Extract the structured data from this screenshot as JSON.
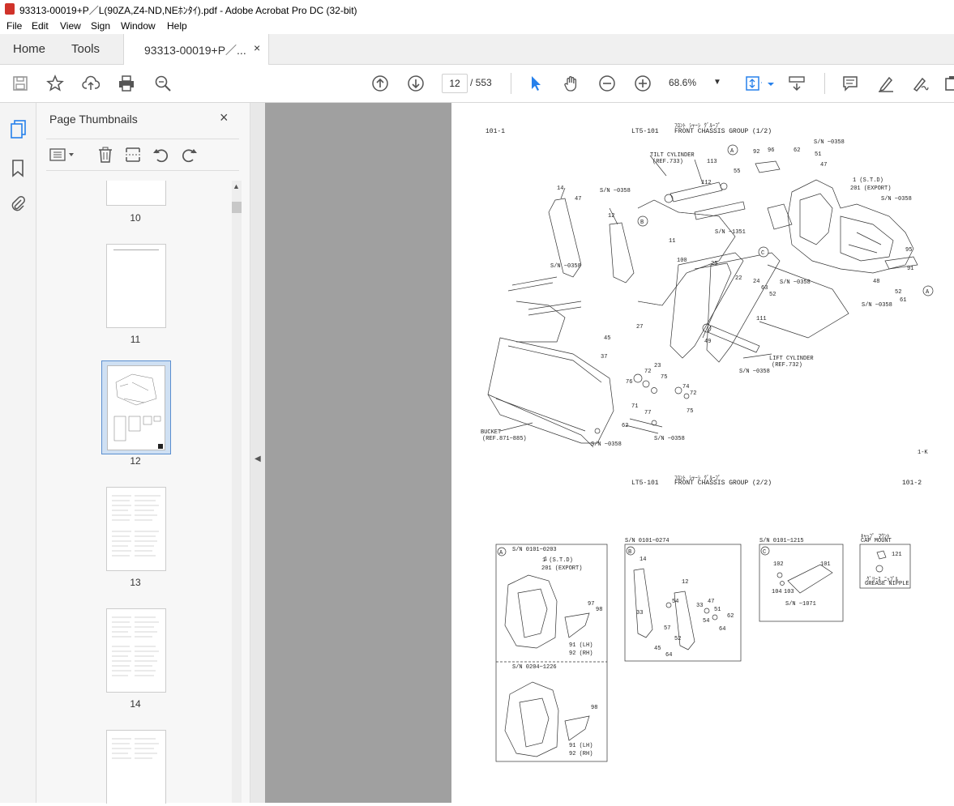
{
  "window": {
    "title": "93313-00019+P／L(90ZA,Z4-ND,NEﾎﾝﾀｲ).pdf - Adobe Acrobat Pro DC (32-bit)"
  },
  "menu": [
    "File",
    "Edit",
    "View",
    "Sign",
    "Window",
    "Help"
  ],
  "tabs": {
    "home": "Home",
    "tools": "Tools",
    "document": "93313-00019+P／...",
    "close": "×"
  },
  "toolbar": {
    "page_current": "12",
    "page_total": "/ 553",
    "zoom": "68.6%"
  },
  "thumbnails_panel": {
    "title": "Page Thumbnails",
    "close": "×",
    "pages": [
      "10",
      "11",
      "12",
      "13",
      "14"
    ],
    "selected": "12"
  },
  "document": {
    "top_left_code": "101-1",
    "top_title_code": "LT5-101",
    "top_title_kana": "ﾌﾛﾝﾄ ｼｬｰｼ ｸﾞﾙｰﾌﾟ",
    "top_title": "FRONT CHASSIS GROUP (1/2)",
    "bottom_title_code": "LT5-101",
    "bottom_title_kana": "ﾌﾛﾝﾄ ｼｬｰｼ ｸﾞﾙｰﾌﾟ",
    "bottom_title": "FRONT CHASSIS GROUP (2/2)",
    "bottom_right_code": "101-2",
    "corner_mark": "1-K",
    "labels": {
      "tilt_cylinder": "TILT CYLINDER",
      "tilt_ref": "(REF.733)",
      "lift_cylinder": "LIFT CYLINDER",
      "lift_ref": "(REF.732)",
      "bucket": "BUCKET",
      "bucket_ref": "(REF.871~885)",
      "std": "1 (S.T.D)",
      "export": "201 (EXPORT)",
      "sn_358": "S/N ~0358",
      "sn_1351": "S/N ~1351"
    },
    "insets": {
      "a_header": "S/N 0101~0203",
      "a_lower_header": "S/N 0204~1226",
      "a_lh": "91 (LH)",
      "a_rh": "92 (RH)",
      "b_header": "S/N 0101~0274",
      "c_header": "S/N 0101~1215",
      "c_sn": "S/N ~1071",
      "cap_kana": "ｷｬｯﾌﾟ ﾏｳﾝﾄ",
      "cap_mount": "CAP MOUNT",
      "grease_kana": "ｸﾞﾘｰｽ ﾆｯﾌﾟﾙ",
      "grease_nipple": "GREASE NIPPLE"
    }
  },
  "colors": {
    "accent": "#2680eb",
    "gray_bg": "#a0a0a0"
  }
}
